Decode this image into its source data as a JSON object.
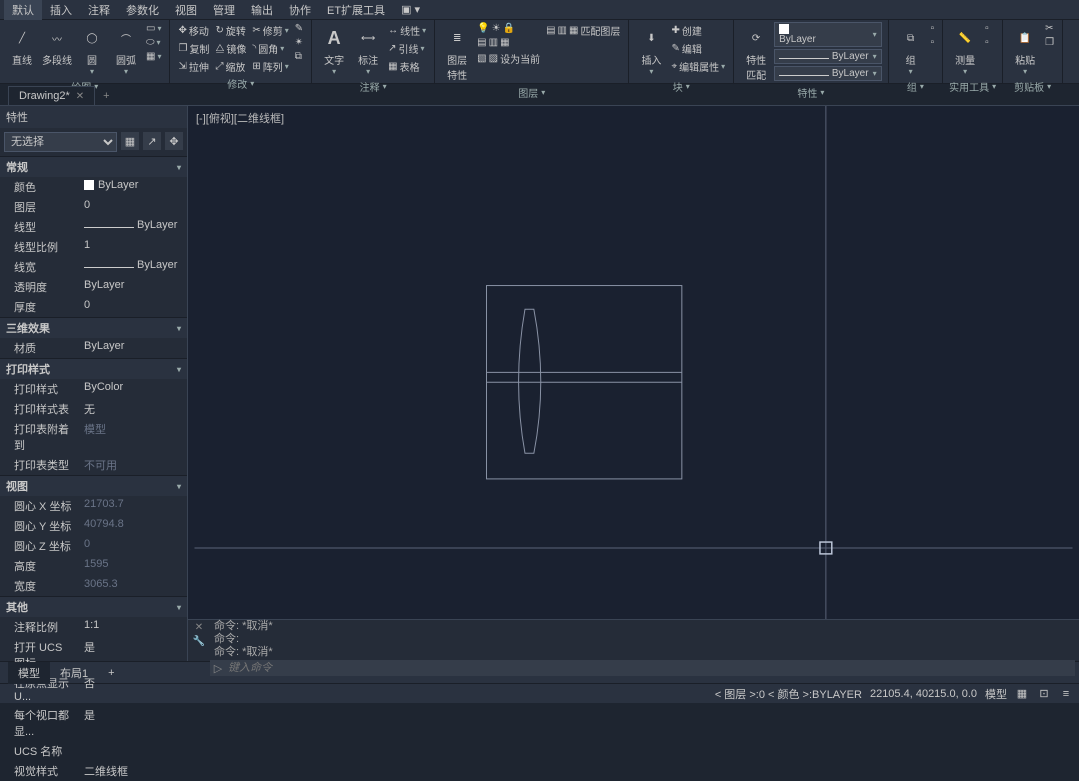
{
  "menubar": [
    "默认",
    "插入",
    "注释",
    "参数化",
    "视图",
    "管理",
    "输出",
    "协作",
    "ET扩展工具"
  ],
  "ribbon_groups": [
    {
      "label": "绘图",
      "big": [
        {
          "name": "line",
          "label": "直线"
        },
        {
          "name": "polyline",
          "label": "多段线"
        },
        {
          "name": "circle",
          "label": "圆"
        },
        {
          "name": "arc",
          "label": "圆弧"
        }
      ]
    },
    {
      "label": "修改",
      "rows": [
        [
          "移动",
          "旋转",
          "修剪"
        ],
        [
          "复制",
          "镜像",
          "圆角"
        ],
        [
          "拉伸",
          "缩放",
          "阵列"
        ]
      ]
    },
    {
      "label": "注释",
      "big": [
        {
          "name": "text",
          "label": "文字"
        },
        {
          "name": "dim",
          "label": "标注"
        }
      ],
      "rows": [
        [
          "线性"
        ],
        [
          "引线"
        ],
        [
          "表格"
        ]
      ]
    },
    {
      "label": "图层",
      "big": [
        {
          "name": "layerprop",
          "label": "图层\n特性"
        }
      ],
      "extra": "设为当前"
    },
    {
      "label": "块",
      "big": [
        {
          "name": "insert",
          "label": "插入"
        }
      ],
      "rows": [
        [
          "创建"
        ],
        [
          "编辑"
        ],
        [
          "编辑属性"
        ]
      ]
    },
    {
      "label": "特性",
      "big": [
        {
          "name": "propmatch",
          "label": "特性\n匹配"
        }
      ],
      "combos": [
        "ByLayer",
        "ByLayer",
        "ByLayer"
      ]
    },
    {
      "label": "组",
      "big": [
        {
          "name": "group",
          "label": "组"
        }
      ]
    },
    {
      "label": "实用工具",
      "rows": [
        [
          "测量"
        ]
      ]
    },
    {
      "label": "剪贴板",
      "big": [
        {
          "name": "paste",
          "label": "粘贴"
        }
      ]
    }
  ],
  "doc_tab": {
    "name": "Drawing2*",
    "active": true
  },
  "properties": {
    "title": "特性",
    "selector": "无选择",
    "sections": [
      {
        "title": "常规",
        "rows": [
          {
            "label": "颜色",
            "value": "ByLayer",
            "swatch": true
          },
          {
            "label": "图层",
            "value": "0"
          },
          {
            "label": "线型",
            "value": "ByLayer",
            "line": true
          },
          {
            "label": "线型比例",
            "value": "1"
          },
          {
            "label": "线宽",
            "value": "ByLayer",
            "line": true
          },
          {
            "label": "透明度",
            "value": "ByLayer"
          },
          {
            "label": "厚度",
            "value": "0"
          }
        ]
      },
      {
        "title": "三维效果",
        "rows": [
          {
            "label": "材质",
            "value": "ByLayer"
          }
        ]
      },
      {
        "title": "打印样式",
        "rows": [
          {
            "label": "打印样式",
            "value": "ByColor"
          },
          {
            "label": "打印样式表",
            "value": "无"
          },
          {
            "label": "打印表附着到",
            "value": "模型",
            "dim": true
          },
          {
            "label": "打印表类型",
            "value": "不可用",
            "dim": true
          }
        ]
      },
      {
        "title": "视图",
        "rows": [
          {
            "label": "圆心 X 坐标",
            "value": "21703.7",
            "dim": true
          },
          {
            "label": "圆心 Y 坐标",
            "value": "40794.8",
            "dim": true
          },
          {
            "label": "圆心 Z 坐标",
            "value": "0",
            "dim": true
          },
          {
            "label": "高度",
            "value": "1595",
            "dim": true
          },
          {
            "label": "宽度",
            "value": "3065.3",
            "dim": true
          }
        ]
      },
      {
        "title": "其他",
        "rows": [
          {
            "label": "注释比例",
            "value": "1:1"
          },
          {
            "label": "打开 UCS 图标",
            "value": "是"
          },
          {
            "label": "在原点显示 U...",
            "value": "否"
          },
          {
            "label": "每个视口都显...",
            "value": "是"
          },
          {
            "label": "UCS 名称",
            "value": ""
          },
          {
            "label": "视觉样式",
            "value": "二维线框"
          }
        ]
      }
    ]
  },
  "viewport_label": "[-][俯视][二维线框]",
  "cmd": {
    "history": [
      "命令: *取消*",
      "命令:",
      "命令: *取消*"
    ],
    "placeholder": "键入命令"
  },
  "layout_tabs": [
    "模型",
    "布局1"
  ],
  "statusbar": {
    "layer": "< 图层 >:0 < 颜色 >:BYLAYER",
    "coords": "22105.4, 40215.0, 0.0",
    "model": "模型"
  }
}
